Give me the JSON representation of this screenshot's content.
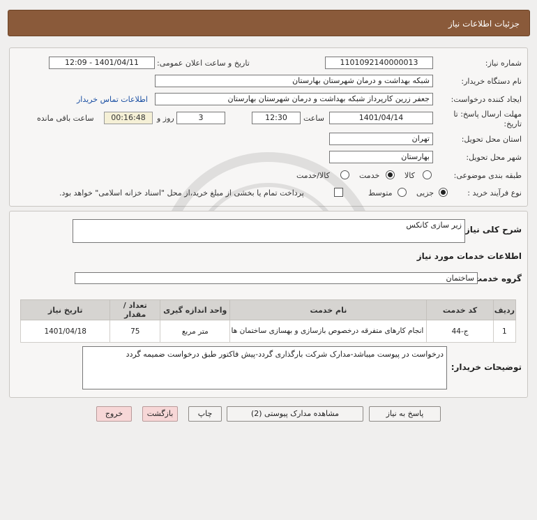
{
  "header": {
    "title": "جزئیات اطلاعات نیاز"
  },
  "fields": {
    "need_number_label": "شماره نیاز:",
    "need_number": "1101092140000013",
    "announce_label": "تاریخ و ساعت اعلان عمومی:",
    "announce_value": "1401/04/11 - 12:09",
    "buyer_org_label": "نام دستگاه خریدار:",
    "buyer_org": "شبکه بهداشت و درمان شهرستان بهارستان",
    "creator_label": "ایجاد کننده درخواست:",
    "creator": "جعفر زرین کارپرداز شبکه بهداشت و درمان شهرستان بهارستان",
    "contact_link": "اطلاعات تماس خریدار",
    "deadline_label_1": "مهلت ارسال پاسخ: تا",
    "deadline_label_2": "تاریخ:",
    "deadline_date": "1401/04/14",
    "time_label": "ساعت",
    "deadline_time": "12:30",
    "days_label": "روز و",
    "days": "3",
    "timer": "00:16:48",
    "remaining_label": "ساعت باقی مانده",
    "province_label": "استان محل تحویل:",
    "province": "تهران",
    "city_label": "شهر محل تحویل:",
    "city": "بهارستان",
    "category_label": "طبقه بندی موضوعی:",
    "category_options": [
      "کالا",
      "خدمت",
      "کالا/خدمت"
    ],
    "process_label": "نوع فرآیند خرید :",
    "process_options": [
      "جزیی",
      "متوسط"
    ],
    "payment_note": "پرداخت تمام یا بخشی از مبلغ خرید،از محل \"اسناد خزانه اسلامی\" خواهد بود."
  },
  "description": {
    "label": "شرح کلی نیاز:",
    "value": "زیر سازی کانکس",
    "services_heading": "اطلاعات خدمات مورد نیاز",
    "group_label": "گروه خدمت:",
    "group_value": "ساختمان"
  },
  "table": {
    "headers": [
      "ردیف",
      "کد خدمت",
      "نام خدمت",
      "واحد اندازه گیری",
      "تعداد / مقدار",
      "تاریخ نیاز"
    ],
    "rows": [
      [
        "1",
        "ج-44",
        "انجام کارهای متفرقه درخصوص بازسازی و بهسازی ساختمان ها",
        "متر مربع",
        "75",
        "1401/04/18"
      ]
    ]
  },
  "buyer_notes": {
    "label": "توضیحات خریدار:",
    "value": "درخواست در پیوست میباشد-مدارک شرکت بارگذاری گردد-پیش فاکتور طبق درخواست ضمیمه گردد"
  },
  "buttons": {
    "reply": "پاسخ به نیاز",
    "attachments": "مشاهده مدارک پیوستی (2)",
    "print": "چاپ",
    "back": "بازگشت",
    "exit": "خروج"
  }
}
